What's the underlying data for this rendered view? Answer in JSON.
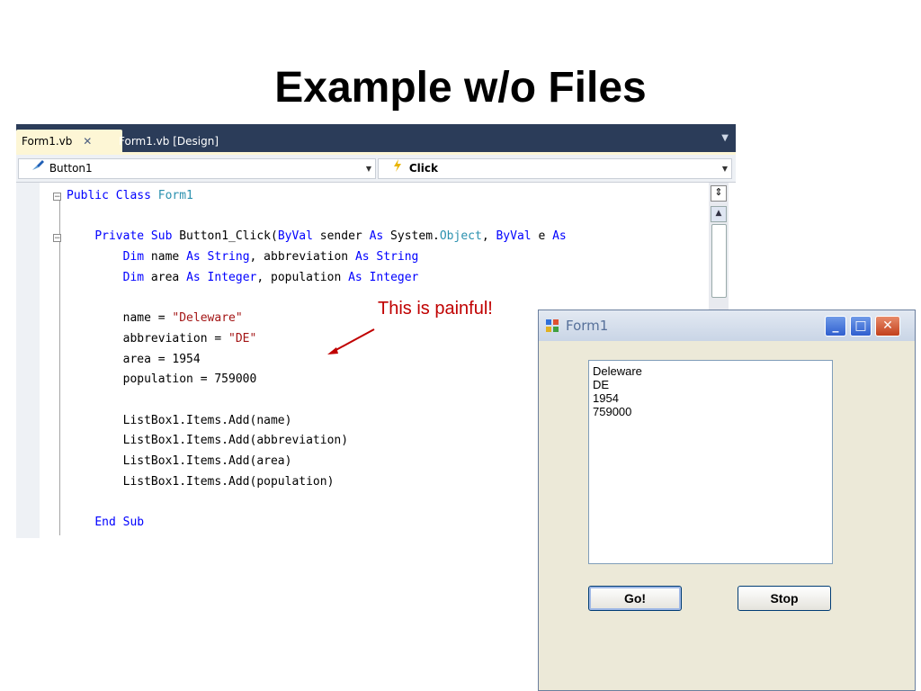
{
  "slide": {
    "title": "Example w/o Files"
  },
  "ide": {
    "tabs": [
      {
        "label": "Form1.vb",
        "close": "✕"
      },
      {
        "label": "Form1.vb [Design]"
      }
    ],
    "tab_dropdown": "▼",
    "object_combo": "Button1",
    "event_combo": "Click",
    "fold_symbol": "−"
  },
  "code_lines": [
    [
      {
        "t": "Public Class ",
        "c": "kw"
      },
      {
        "t": "Form1",
        "c": "ty"
      }
    ],
    [],
    [
      {
        "t": "    "
      },
      {
        "t": "Private Sub ",
        "c": "kw"
      },
      {
        "t": "Button1_Click("
      },
      {
        "t": "ByVal",
        "c": "kw"
      },
      {
        "t": " sender "
      },
      {
        "t": "As",
        "c": "kw"
      },
      {
        "t": " System."
      },
      {
        "t": "Object",
        "c": "ty"
      },
      {
        "t": ", "
      },
      {
        "t": "ByVal",
        "c": "kw"
      },
      {
        "t": " e "
      },
      {
        "t": "As",
        "c": "kw"
      }
    ],
    [
      {
        "t": "        "
      },
      {
        "t": "Dim",
        "c": "kw"
      },
      {
        "t": " name "
      },
      {
        "t": "As String",
        "c": "kw"
      },
      {
        "t": ", abbreviation "
      },
      {
        "t": "As String",
        "c": "kw"
      }
    ],
    [
      {
        "t": "        "
      },
      {
        "t": "Dim",
        "c": "kw"
      },
      {
        "t": " area "
      },
      {
        "t": "As Integer",
        "c": "kw"
      },
      {
        "t": ", population "
      },
      {
        "t": "As Integer",
        "c": "kw"
      }
    ],
    [],
    [
      {
        "t": "        name = "
      },
      {
        "t": "\"Deleware\"",
        "c": "st"
      }
    ],
    [
      {
        "t": "        abbreviation = "
      },
      {
        "t": "\"DE\"",
        "c": "st"
      }
    ],
    [
      {
        "t": "        area = 1954"
      }
    ],
    [
      {
        "t": "        population = 759000"
      }
    ],
    [],
    [
      {
        "t": "        ListBox1.Items.Add(name)"
      }
    ],
    [
      {
        "t": "        ListBox1.Items.Add(abbreviation)"
      }
    ],
    [
      {
        "t": "        ListBox1.Items.Add(area)"
      }
    ],
    [
      {
        "t": "        ListBox1.Items.Add(population)"
      }
    ],
    [],
    [
      {
        "t": "    "
      },
      {
        "t": "End Sub",
        "c": "kw"
      }
    ]
  ],
  "annotation": "This is painful!",
  "form": {
    "title": "Form1",
    "listbox_items": [
      "Deleware",
      "DE",
      "1954",
      "759000"
    ],
    "go_label": "Go!",
    "stop_label": "Stop",
    "close_glyph": "✕",
    "min_glyph": "_",
    "max_glyph": "□"
  },
  "colors": {
    "keyword": "#0000ff",
    "type": "#2b91af",
    "string": "#a31515",
    "annotation": "#c00000"
  }
}
